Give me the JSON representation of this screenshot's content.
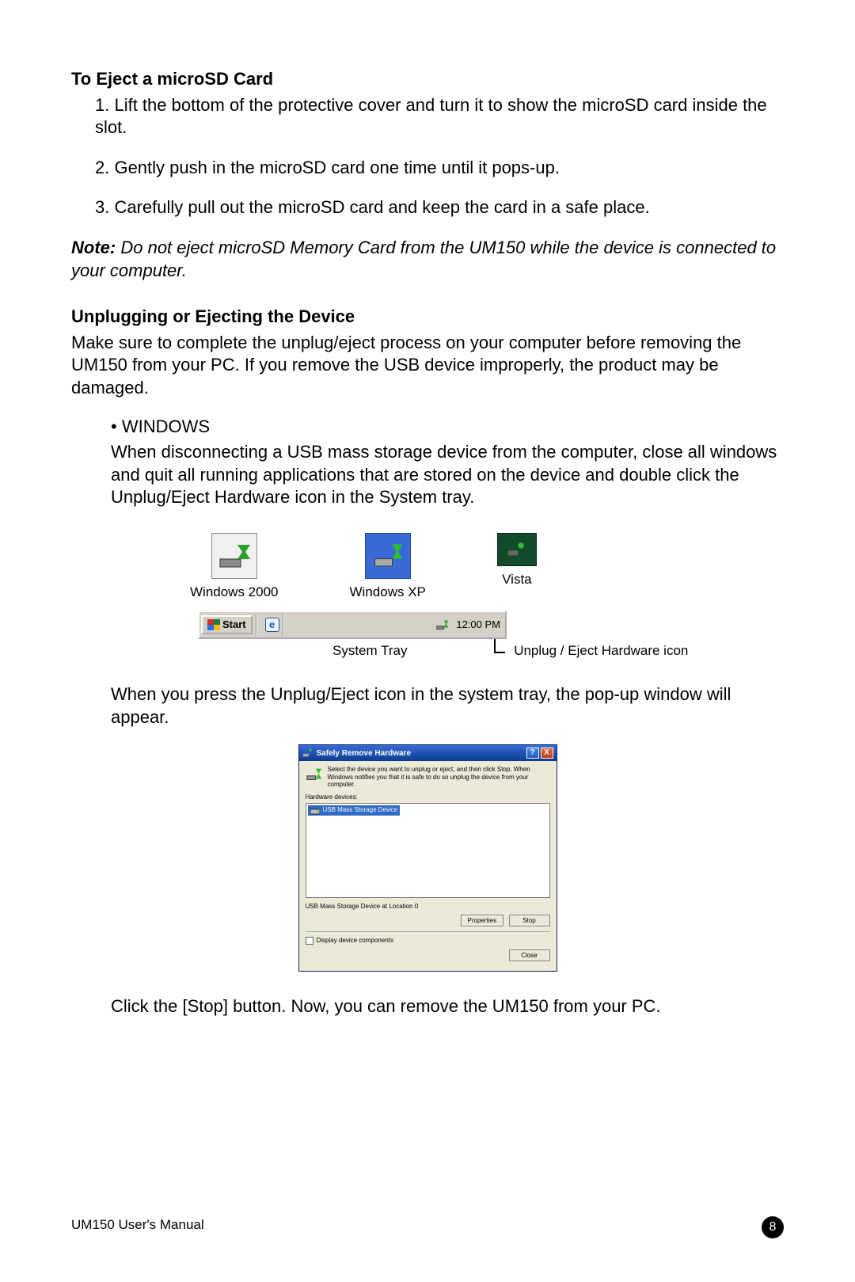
{
  "section1": {
    "heading": "To Eject a microSD Card",
    "steps": [
      "1. Lift the bottom of the protective cover and turn it to show the microSD card inside the slot.",
      "2. Gently push in the microSD card one time until it pops-up.",
      "3. Carefully pull out the microSD card and keep the card in a safe place."
    ],
    "note_label": "Note:",
    "note_body": "Do not eject microSD Memory Card from the UM150 while the device is connected to your computer."
  },
  "section2": {
    "heading": "Unplugging or Ejecting the Device",
    "intro": "Make sure to complete the unplug/eject process on your computer before removing the UM150 from your PC. If you remove the USB device improperly, the product may be damaged.",
    "bullet_heading": "• WINDOWS",
    "bullet_para": "When disconnecting a USB mass storage device from the computer, close all windows and quit all running applications that are stored on the device and double click the Unplug/Eject Hardware icon in the System tray.",
    "icons": {
      "w2000": "Windows 2000",
      "wxp": "Windows XP",
      "vista": "Vista"
    },
    "taskbar": {
      "start": "Start",
      "time": "12:00 PM",
      "caption_tray": "System Tray",
      "caption_icon": "Unplug / Eject Hardware icon"
    },
    "after_tray": "When you press the Unplug/Eject icon in the system tray, the pop-up window will appear.",
    "final": "Click the [Stop] button. Now, you can remove the UM150 from your PC."
  },
  "dialog": {
    "title": "Safely Remove Hardware",
    "instr": "Select the device you want to unplug or eject, and then click Stop. When Windows notifies you that it is safe to do so unplug the device from your computer.",
    "list_label": "Hardware devices:",
    "list_item": "USB Mass Storage Device",
    "status": "USB Mass Storage Device at Location 0",
    "btn_properties": "Properties",
    "btn_stop": "Stop",
    "check_label": "Display device components",
    "btn_close": "Close"
  },
  "footer": {
    "left": "UM150 User's Manual",
    "page": "8"
  }
}
